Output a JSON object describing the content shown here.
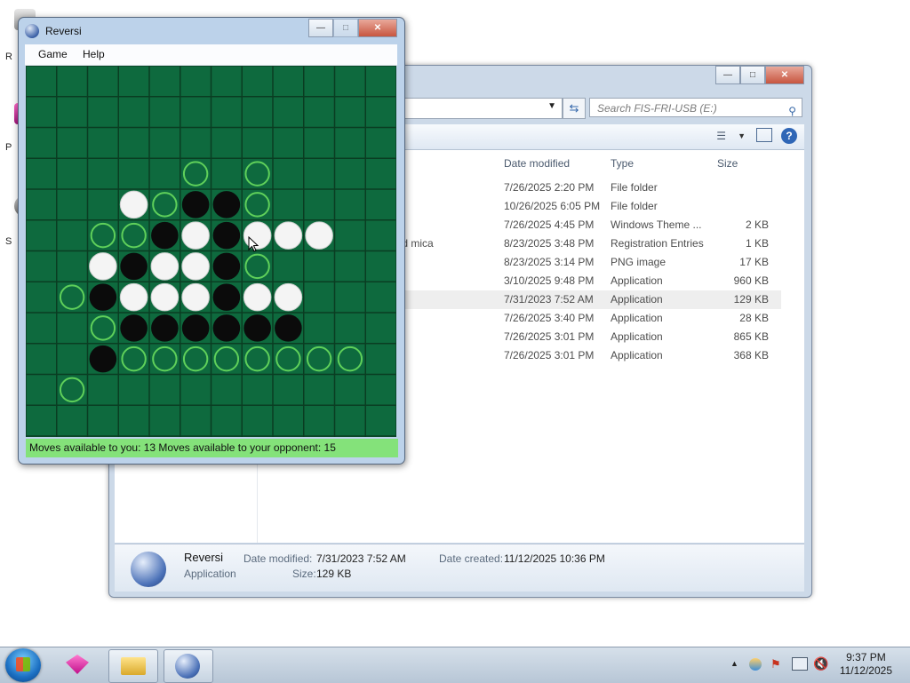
{
  "desktop": {
    "icons": [
      {
        "label": "R",
        "name": "recycle-bin"
      },
      {
        "label": "P",
        "name": "program-shortcut"
      },
      {
        "label": "S",
        "name": "setup-shortcut"
      }
    ]
  },
  "explorer": {
    "search_placeholder": "Search FIS-FRI-USB (E:)",
    "columns": [
      "Date modified",
      "Type",
      "Size"
    ],
    "rows": [
      {
        "name": "",
        "date": "7/26/2025 2:20 PM",
        "type": "File folder",
        "size": ""
      },
      {
        "name": "",
        "date": "10/26/2025 6:05 PM",
        "type": "File folder",
        "size": ""
      },
      {
        "name": "",
        "date": "7/26/2025 4:45 PM",
        "type": "Windows Theme ...",
        "size": "2 KB"
      },
      {
        "name": "and mica",
        "date": "8/23/2025 3:48 PM",
        "type": "Registration Entries",
        "size": "1 KB"
      },
      {
        "name": "",
        "date": "8/23/2025 3:14 PM",
        "type": "PNG image",
        "size": "17 KB"
      },
      {
        "name": "",
        "date": "3/10/2025 9:48 PM",
        "type": "Application",
        "size": "960 KB"
      },
      {
        "name": "",
        "date": "7/31/2023 7:52 AM",
        "type": "Application",
        "size": "129 KB",
        "selected": true
      },
      {
        "name": "",
        "date": "7/26/2025 3:40 PM",
        "type": "Application",
        "size": "28 KB"
      },
      {
        "name": "",
        "date": "7/26/2025 3:01 PM",
        "type": "Application",
        "size": "865 KB"
      },
      {
        "name": "",
        "date": "7/26/2025 3:01 PM",
        "type": "Application",
        "size": "368 KB"
      }
    ],
    "details": {
      "name": "Reversi",
      "kind": "Application",
      "date_modified_label": "Date modified:",
      "date_modified": "7/31/2023 7:52 AM",
      "size_label": "Size:",
      "size": "129 KB",
      "date_created_label": "Date created:",
      "date_created": "11/12/2025 10:36 PM"
    }
  },
  "reversi": {
    "title": "Reversi",
    "menu": [
      "Game",
      "Help"
    ],
    "status": "Moves available to you:  13  Moves available to your opponent:  15",
    "colors": {
      "board": "#0e6a3e",
      "grid": "#0a3d22",
      "hint": "#5fd05a",
      "white": "#f4f4f4",
      "black": "#0b0b0b",
      "status_bg": "#84e27a"
    },
    "board": [
      "............",
      "............",
      "............",
      ".....o.o....",
      "...WoBBo....",
      "..ooBWBWWW..",
      "..WBWWBo....",
      ".oBWWWBWW...",
      "..oBBBBBB...",
      "..BoooooooO.",
      ".o..........",
      "............"
    ]
  },
  "taskbar": {
    "buttons": [
      "shapes-app",
      "file-explorer",
      "reversi"
    ],
    "clock_time": "9:37 PM",
    "clock_date": "11/12/2025"
  }
}
